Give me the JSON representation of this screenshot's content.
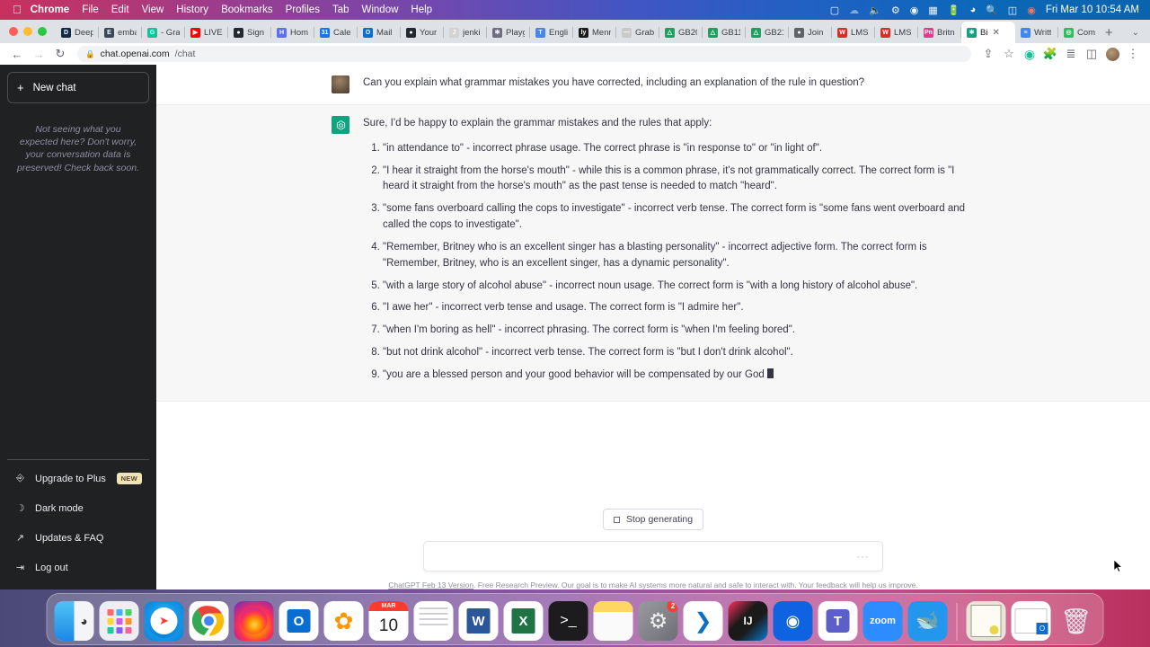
{
  "menubar": {
    "apple": "",
    "items": [
      {
        "label": "Chrome",
        "bold": true
      },
      {
        "label": "File"
      },
      {
        "label": "Edit"
      },
      {
        "label": "View"
      },
      {
        "label": "History"
      },
      {
        "label": "Bookmarks"
      },
      {
        "label": "Profiles"
      },
      {
        "label": "Tab"
      },
      {
        "label": "Window"
      },
      {
        "label": "Help"
      }
    ],
    "status_icons": [
      "box-icon",
      "cloud-icon",
      "volume-icon",
      "settings-gear-icon",
      "record-icon",
      "display-icon",
      "battery-icon",
      "wifi-icon",
      "search-icon",
      "control-center-icon",
      "user-icon"
    ],
    "clock": "Fri Mar 10  10:54 AM"
  },
  "browser": {
    "tabs": [
      {
        "label": "Deep",
        "favicon": "deepl-icon",
        "color": "#0f2b46",
        "glyph": "D",
        "active": false
      },
      {
        "label": "emba",
        "favicon": "embark-icon",
        "color": "#3b4a5a",
        "glyph": "E",
        "active": false
      },
      {
        "label": "- Gra",
        "favicon": "grammarly-icon",
        "color": "#15c39a",
        "glyph": "G",
        "active": false
      },
      {
        "label": "LIVE",
        "favicon": "youtube-icon",
        "color": "#ff0000",
        "glyph": "▶",
        "active": false
      },
      {
        "label": "Sign",
        "favicon": "github-icon",
        "color": "#24292f",
        "glyph": "●",
        "active": false
      },
      {
        "label": "Hom",
        "favicon": "home-icon",
        "color": "#5b6ef5",
        "glyph": "H",
        "active": false
      },
      {
        "label": "Cale",
        "favicon": "calendar-icon",
        "color": "#1a73e8",
        "glyph": "31",
        "active": false
      },
      {
        "label": "Mail",
        "favicon": "outlook-icon",
        "color": "#0a6ed1",
        "glyph": "O",
        "active": false
      },
      {
        "label": "Your",
        "favicon": "github-icon",
        "color": "#24292f",
        "glyph": "●",
        "active": false
      },
      {
        "label": "jenki",
        "favicon": "jenkins-icon",
        "color": "#d3d3d3",
        "glyph": "J",
        "active": false
      },
      {
        "label": "Playg",
        "favicon": "openai-icon",
        "color": "#6e6e80",
        "glyph": "✻",
        "active": false
      },
      {
        "label": "Engli",
        "favicon": "translate-icon",
        "color": "#4a86e8",
        "glyph": "T",
        "active": false
      },
      {
        "label": "Menr",
        "favicon": "lyrics-icon",
        "color": "#1b1b1b",
        "glyph": "ly",
        "active": false
      },
      {
        "label": "Grab",
        "favicon": "grab-icon",
        "color": "#c9c9c9",
        "glyph": "—",
        "active": false
      },
      {
        "label": "GB20",
        "favicon": "drive-icon",
        "color": "#1aa260",
        "glyph": "△",
        "active": false
      },
      {
        "label": "GB11",
        "favicon": "drive-icon",
        "color": "#1aa260",
        "glyph": "△",
        "active": false
      },
      {
        "label": "GB21",
        "favicon": "drive-icon",
        "color": "#1aa260",
        "glyph": "△",
        "active": false
      },
      {
        "label": "Join",
        "favicon": "globe-icon",
        "color": "#5f6368",
        "glyph": "●",
        "active": false
      },
      {
        "label": "LMS",
        "favicon": "lms-icon",
        "color": "#d93025",
        "glyph": "W",
        "active": false
      },
      {
        "label": "LMS",
        "favicon": "lms-icon",
        "color": "#d93025",
        "glyph": "W",
        "active": false
      },
      {
        "label": "Britn",
        "favicon": "grammarly-premium-icon",
        "color": "#e8388a",
        "glyph": "Pn",
        "active": false
      },
      {
        "label": "Bi",
        "favicon": "openai-icon",
        "color": "#10a37f",
        "glyph": "✻",
        "active": true
      },
      {
        "label": "Writt",
        "favicon": "docs-icon",
        "color": "#4285f4",
        "glyph": "≡",
        "active": false
      },
      {
        "label": "Com",
        "favicon": "evernote-icon",
        "color": "#2dbe60",
        "glyph": "◎",
        "active": false
      }
    ],
    "new_tab_label": "+",
    "tab_list_chevron": "⌄",
    "nav": {
      "back": "←",
      "forward": "→",
      "reload": "↻"
    },
    "omnibox": {
      "lock": "🔒",
      "host": "chat.openai.com",
      "path": "/chat"
    },
    "toolbar_icons": [
      "share-icon",
      "bookmark-star-icon",
      "grammarly-extension-icon",
      "extensions-puzzle-icon",
      "reading-list-icon",
      "side-panel-icon",
      "profile-avatar",
      "chrome-menu-icon"
    ]
  },
  "sidebar": {
    "new_chat": "New chat",
    "notice": "Not seeing what you expected here? Don't worry, your conversation data is preserved! Check back soon.",
    "items": [
      {
        "label": "Upgrade to Plus",
        "icon": "person-icon",
        "badge": "NEW"
      },
      {
        "label": "Dark mode",
        "icon": "moon-icon",
        "badge": ""
      },
      {
        "label": "Updates & FAQ",
        "icon": "external-link-icon",
        "badge": ""
      },
      {
        "label": "Log out",
        "icon": "logout-icon",
        "badge": ""
      }
    ]
  },
  "conversation": {
    "user_message": "Can you explain what grammar mistakes you have corrected, including an explanation of the rule in question?",
    "assistant_intro": "Sure, I'd be happy to explain the grammar mistakes and the rules that apply:",
    "assistant_list": [
      "\"in attendance to\" - incorrect phrase usage. The correct phrase is \"in response to\" or \"in light of\".",
      "\"I hear it straight from the horse's mouth\" - while this is a common phrase, it's not grammatically correct. The correct form is \"I heard it straight from the horse's mouth\" as the past tense is needed to match \"heard\".",
      "\"some fans overboard calling the cops to investigate\" - incorrect verb tense. The correct form is \"some fans went overboard and called the cops to investigate\".",
      "\"Remember, Britney who is an excellent singer has a blasting personality\" - incorrect adjective form. The correct form is \"Remember, Britney, who is an excellent singer, has a dynamic personality\".",
      "\"with a large story of alcohol abuse\" - incorrect noun usage. The correct form is \"with a long history of alcohol abuse\".",
      "\"I awe her\" - incorrect verb tense and usage. The correct form is \"I admire her\".",
      "\"when I'm boring as hell\" - incorrect phrasing. The correct form is \"when I'm feeling bored\".",
      "\"but not drink alcohol\" - incorrect verb tense. The correct form is \"but I don't drink alcohol\".",
      "\"you are a blessed person and your good behavior will be compensated by our God"
    ]
  },
  "composer": {
    "stop_generating": "Stop generating",
    "input_value": "",
    "input_placeholder": "",
    "loading_dots": "···",
    "footnote_link": "ChatGPT Feb 13 Version",
    "footnote_rest": ". Free Research Preview. Our goal is to make AI systems more natural and safe to interact with. Your feedback will help us improve."
  },
  "dock": {
    "apps": [
      {
        "name": "finder-icon",
        "glyph": "🙂",
        "bg": "linear-gradient(135deg,#27c0f5 0%,#1a8fe0 49%,#ffffff 50%,#f0f0f0 100%)",
        "running": true,
        "badge": ""
      },
      {
        "name": "launchpad-icon",
        "glyph": "⁙",
        "bg": "#ededf2",
        "running": false,
        "badge": ""
      },
      {
        "name": "safari-icon",
        "glyph": "🧭",
        "bg": "radial-gradient(circle at 50% 50%,#ffffff 28%,#1da1f2 30%,#0b84d6 100%)",
        "running": false,
        "badge": ""
      },
      {
        "name": "chrome-icon",
        "glyph": "",
        "bg": "#fff",
        "running": true,
        "badge": ""
      },
      {
        "name": "firefox-icon",
        "glyph": "",
        "bg": "radial-gradient(circle at 55% 62%,#ffd33d 4%,#ff8a00 28%,#ff2d55 52%,#7a2bbd 92%)",
        "running": true,
        "badge": ""
      },
      {
        "name": "outlook-icon",
        "glyph": "O",
        "bg": "#fff",
        "running": true,
        "badge": ""
      },
      {
        "name": "photos-icon",
        "glyph": "✿",
        "bg": "#fff",
        "running": false,
        "badge": ""
      },
      {
        "name": "calendar-icon",
        "glyph": "10",
        "bg": "#fff",
        "running": false,
        "badge": ""
      },
      {
        "name": "reminders-icon",
        "glyph": "≡",
        "bg": "#fff",
        "running": false,
        "badge": ""
      },
      {
        "name": "word-icon",
        "glyph": "W",
        "bg": "#fff",
        "running": true,
        "badge": ""
      },
      {
        "name": "excel-icon",
        "glyph": "X",
        "bg": "#fff",
        "running": true,
        "badge": ""
      },
      {
        "name": "terminal-icon",
        "glyph": ">_",
        "bg": "#1c1c1e",
        "running": false,
        "badge": ""
      },
      {
        "name": "notes-icon",
        "glyph": "",
        "bg": "#fff",
        "running": false,
        "badge": ""
      },
      {
        "name": "system-settings-icon",
        "glyph": "⚙",
        "bg": "linear-gradient(135deg,#9a9aa0,#6e6e76)",
        "running": false,
        "badge": "2"
      },
      {
        "name": "vscode-icon",
        "glyph": "⌨",
        "bg": "#fff",
        "running": true,
        "badge": ""
      },
      {
        "name": "intellij-idea-icon",
        "glyph": "IJ",
        "bg": "#111",
        "running": false,
        "badge": ""
      },
      {
        "name": "postman-icon",
        "glyph": "◉",
        "bg": "#1063e0",
        "running": false,
        "badge": ""
      },
      {
        "name": "teams-icon",
        "glyph": "T",
        "bg": "#fff",
        "running": true,
        "badge": ""
      },
      {
        "name": "zoom-icon",
        "glyph": "zoom",
        "bg": "#2d8cff",
        "running": true,
        "badge": ""
      },
      {
        "name": "docker-icon",
        "glyph": "🐳",
        "bg": "#2396ed",
        "running": false,
        "badge": ""
      }
    ],
    "files": [
      {
        "name": "certificate-document-icon",
        "glyph": "",
        "bg": "#e8e4d8"
      },
      {
        "name": "document-file-icon",
        "glyph": "",
        "bg": "#ffffff"
      },
      {
        "name": "trash-icon",
        "glyph": "🗑",
        "bg": "transparent"
      }
    ]
  }
}
